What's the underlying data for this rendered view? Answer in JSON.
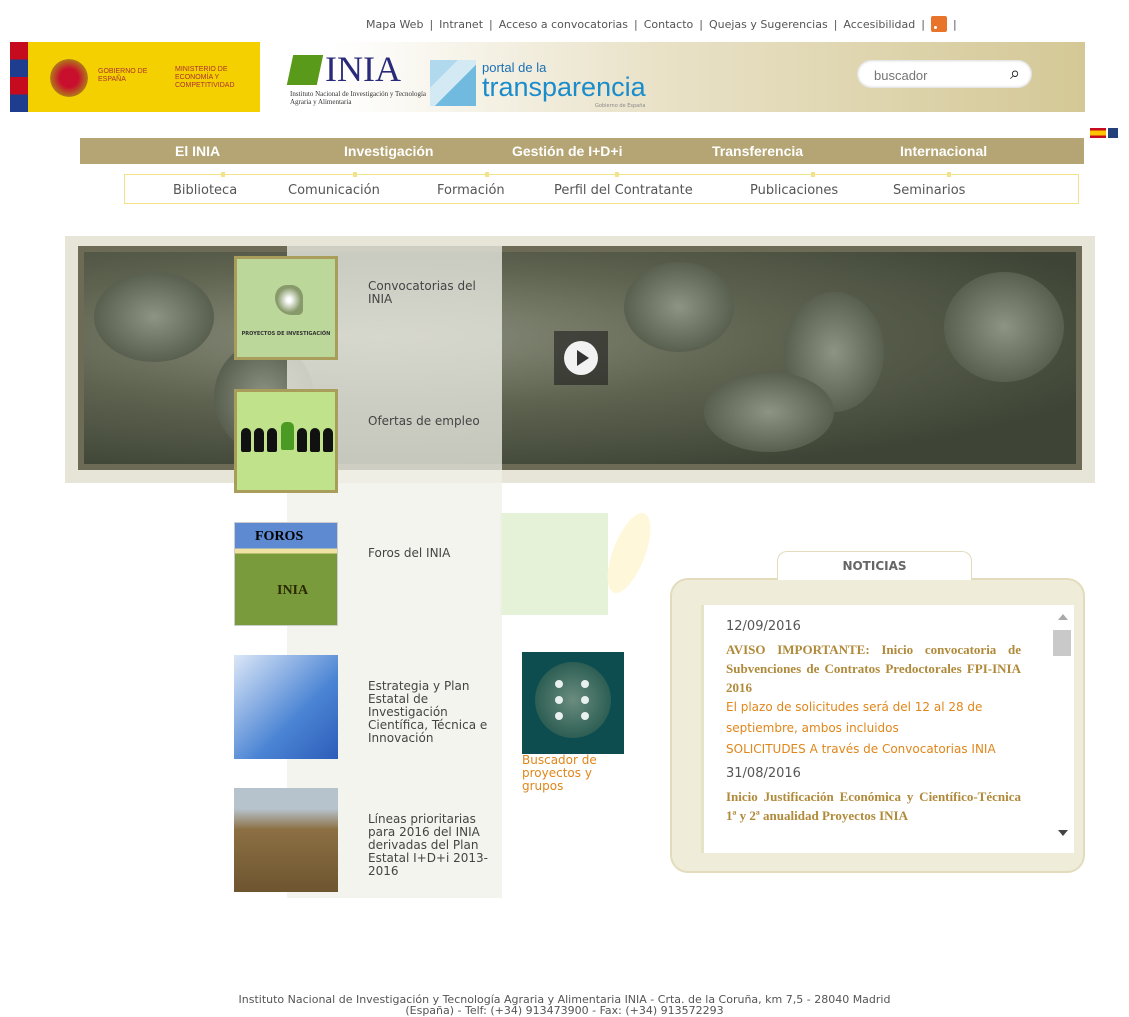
{
  "top_links": [
    "Mapa Web",
    "Intranet",
    "Acceso a convocatorias",
    "Contacto",
    "Quejas y Sugerencias",
    "Accesibilidad"
  ],
  "header": {
    "gobierno": "GOBIERNO DE ESPAÑA",
    "ministerio": "MINISTERIO DE ECONOMÍA Y COMPETITIVIDAD",
    "inia_name": "INIA",
    "inia_sub": "Instituto Nacional de Investigación y Tecnología Agraria y Alimentaria",
    "portal_small": "portal de la",
    "portal_big": "transparencia",
    "portal_gob": "Gobierno de España"
  },
  "search": {
    "placeholder": "buscador"
  },
  "main_nav": [
    "El INIA",
    "Investigación",
    "Gestión de I+D+i",
    "Transferencia",
    "Internacional"
  ],
  "sub_nav": [
    "Biblioteca",
    "Comunicación",
    "Formación",
    "Perfil del Contratante",
    "Publicaciones",
    "Seminarios"
  ],
  "tiles": [
    {
      "label": "Convocatorias del INIA",
      "caption": "PROYECTOS DE INVESTIGACIÓN"
    },
    {
      "label": "Ofertas de empleo"
    },
    {
      "label": "Foros del INIA",
      "caption_top": "FOROS",
      "caption_bottom": "INIA"
    },
    {
      "label": "Estrategia y Plan Estatal de Investigación Científica, Técnica e Innovación"
    },
    {
      "label": "Líneas prioritarias para 2016 del INIA derivadas del Plan Estatal I+D+i 2013-2016"
    }
  ],
  "buscador": {
    "label": "Buscador de proyectos y grupos"
  },
  "news": {
    "tab": "NOTICIAS",
    "items": [
      {
        "date": "12/09/2016",
        "title": "AVISO IMPORTANTE: Inicio convocatoria de Subvenciones de Contratos Predoctorales FPI-INIA 2016",
        "body": "El plazo de solicitudes será del 12 al 28 de septiembre, ambos incluidos",
        "body2": "SOLICITUDES A través de Convocatorias INIA"
      },
      {
        "date": "31/08/2016",
        "title": "Inicio Justificación Económica y Científico-Técnica 1ª y 2ª anualidad Proyectos INIA"
      }
    ]
  },
  "footer": {
    "line1": "Instituto Nacional de Investigación y Tecnología Agraria y Alimentaria INIA - Crta. de la Coruña, km 7,5 - 28040 Madrid",
    "line2": "(España) - Telf: (+34) 913473900 - Fax: (+34) 913572293"
  },
  "colors": {
    "nav_bg": "#b5a574",
    "accent_orange": "#e0861a",
    "news_title": "#b08a3a"
  }
}
